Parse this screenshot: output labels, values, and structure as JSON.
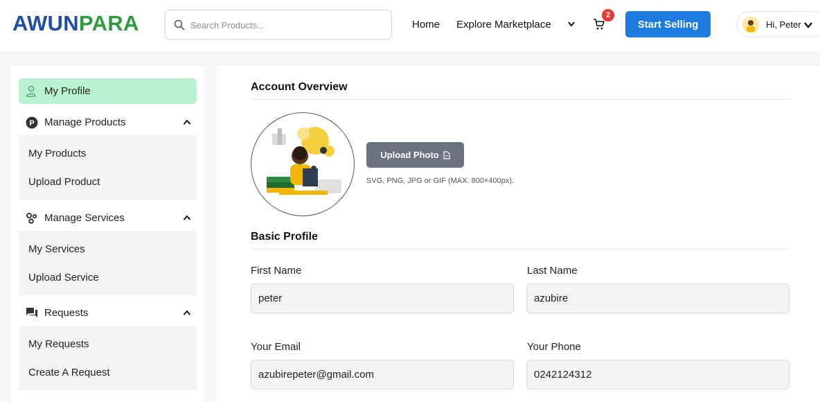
{
  "header": {
    "logo_part1": "AWUN",
    "logo_part2": "PARA",
    "search_placeholder": "Search Products...",
    "nav_home": "Home",
    "nav_explore": "Explore Marketplace",
    "cart_count": "2",
    "start_selling": "Start Selling",
    "user_greeting": "Hi, Peter"
  },
  "sidebar": {
    "my_profile": "My Profile",
    "manage_products": "Manage Products",
    "my_products": "My Products",
    "upload_product": "Upload Product",
    "manage_services": "Manage Services",
    "my_services": "My Services",
    "upload_service": "Upload Service",
    "requests": "Requests",
    "my_requests": "My Requests",
    "create_request": "Create A Request",
    "products_icon_letter": "P"
  },
  "main": {
    "account_overview": "Account Overview",
    "upload_photo": "Upload Photo",
    "upload_hint": "SVG, PNG, JPG or GIF (MAX. 800×400px).",
    "basic_profile": "Basic Profile",
    "first_name_label": "First Name",
    "first_name_value": "peter",
    "last_name_label": "Last Name",
    "last_name_value": "azubire",
    "email_label": "Your Email",
    "email_value": "azubirepeter@gmail.com",
    "phone_label": "Your Phone",
    "phone_value": "0242124312"
  },
  "colors": {
    "brand_blue": "#1f4fa3",
    "brand_green": "#2e9b3d",
    "primary_button": "#1e7be0",
    "active_nav": "#b9f1d1",
    "badge": "#e53935"
  },
  "icons": [
    "search-icon",
    "chevron-down-icon",
    "cart-icon",
    "user-icon",
    "p-circle-icon",
    "chevron-up-icon",
    "gears-icon",
    "chat-icon",
    "file-icon"
  ]
}
